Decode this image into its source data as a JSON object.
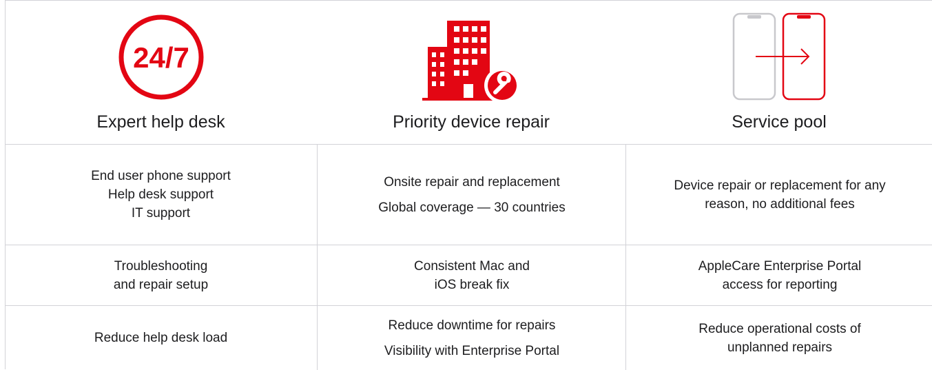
{
  "colors": {
    "accent": "#e30613",
    "grid": "#d2d2d7",
    "text": "#1d1d1f",
    "phone_grey": "#c8c8cc"
  },
  "header": {
    "col1": {
      "title": "Expert help desk",
      "icon": "24-7-icon",
      "icon_text": "24/7"
    },
    "col2": {
      "title": "Priority device repair",
      "icon": "building-repair-icon"
    },
    "col3": {
      "title": "Service pool",
      "icon": "device-swap-icon"
    }
  },
  "rows": [
    {
      "col1": [
        "End user phone support",
        "Help desk support",
        "IT support"
      ],
      "col2": [
        "Onsite repair and replacement",
        "Global coverage — 30 countries"
      ],
      "col3": [
        "Device repair or replacement for any",
        "reason, no additional fees"
      ]
    },
    {
      "col1": [
        "Troubleshooting",
        "and repair setup"
      ],
      "col2": [
        "Consistent Mac and",
        "iOS break fix"
      ],
      "col3": [
        "AppleCare Enterprise Portal",
        "access for reporting"
      ]
    },
    {
      "col1": [
        "Reduce help desk load"
      ],
      "col2": [
        "Reduce downtime for repairs",
        "Visibility with Enterprise Portal"
      ],
      "col3": [
        "Reduce operational costs of",
        "unplanned repairs"
      ]
    }
  ]
}
